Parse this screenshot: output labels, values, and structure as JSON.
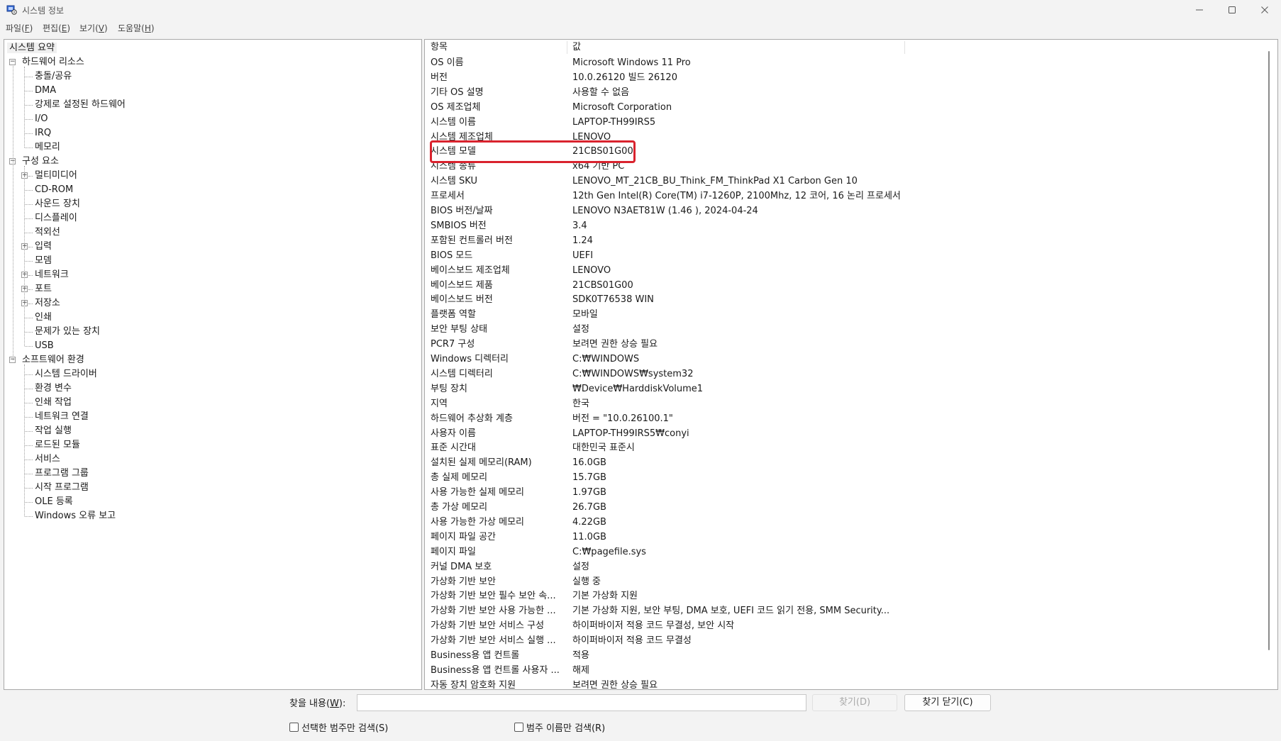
{
  "window": {
    "title": "시스템 정보"
  },
  "menu": [
    {
      "label": "파일(",
      "key": "F",
      "close": ")"
    },
    {
      "label": "편집(",
      "key": "E",
      "close": ")"
    },
    {
      "label": "보기(",
      "key": "V",
      "close": ")"
    },
    {
      "label": "도움말(",
      "key": "H",
      "close": ")"
    }
  ],
  "tree": [
    {
      "label": "시스템 요약",
      "level": 0,
      "expander": "",
      "selected": true
    },
    {
      "label": "하드웨어 리소스",
      "level": 0,
      "expander": "−"
    },
    {
      "label": "충돌/공유",
      "level": 1,
      "expander": ""
    },
    {
      "label": "DMA",
      "level": 1,
      "expander": ""
    },
    {
      "label": "강제로 설정된 하드웨어",
      "level": 1,
      "expander": ""
    },
    {
      "label": "I/O",
      "level": 1,
      "expander": ""
    },
    {
      "label": "IRQ",
      "level": 1,
      "expander": ""
    },
    {
      "label": "메모리",
      "level": 1,
      "expander": ""
    },
    {
      "label": "구성 요소",
      "level": 0,
      "expander": "−"
    },
    {
      "label": "멀티미디어",
      "level": 1,
      "expander": "+"
    },
    {
      "label": "CD-ROM",
      "level": 1,
      "expander": ""
    },
    {
      "label": "사운드 장치",
      "level": 1,
      "expander": ""
    },
    {
      "label": "디스플레이",
      "level": 1,
      "expander": ""
    },
    {
      "label": "적외선",
      "level": 1,
      "expander": ""
    },
    {
      "label": "입력",
      "level": 1,
      "expander": "+"
    },
    {
      "label": "모뎀",
      "level": 1,
      "expander": ""
    },
    {
      "label": "네트워크",
      "level": 1,
      "expander": "+"
    },
    {
      "label": "포트",
      "level": 1,
      "expander": "+"
    },
    {
      "label": "저장소",
      "level": 1,
      "expander": "+"
    },
    {
      "label": "인쇄",
      "level": 1,
      "expander": ""
    },
    {
      "label": "문제가 있는 장치",
      "level": 1,
      "expander": ""
    },
    {
      "label": "USB",
      "level": 1,
      "expander": ""
    },
    {
      "label": "소프트웨어 환경",
      "level": 0,
      "expander": "−"
    },
    {
      "label": "시스템 드라이버",
      "level": 1,
      "expander": ""
    },
    {
      "label": "환경 변수",
      "level": 1,
      "expander": ""
    },
    {
      "label": "인쇄 작업",
      "level": 1,
      "expander": ""
    },
    {
      "label": "네트워크 연결",
      "level": 1,
      "expander": ""
    },
    {
      "label": "작업 실행",
      "level": 1,
      "expander": ""
    },
    {
      "label": "로드된 모듈",
      "level": 1,
      "expander": ""
    },
    {
      "label": "서비스",
      "level": 1,
      "expander": ""
    },
    {
      "label": "프로그램 그룹",
      "level": 1,
      "expander": ""
    },
    {
      "label": "시작 프로그램",
      "level": 1,
      "expander": ""
    },
    {
      "label": "OLE 등록",
      "level": 1,
      "expander": ""
    },
    {
      "label": "Windows 오류 보고",
      "level": 1,
      "expander": ""
    }
  ],
  "table": {
    "headers": [
      "항목",
      "값"
    ],
    "rows": [
      [
        "OS 이름",
        "Microsoft Windows 11 Pro"
      ],
      [
        "버전",
        "10.0.26120 빌드 26120"
      ],
      [
        "기타 OS 설명",
        "사용할 수 없음"
      ],
      [
        "OS 제조업체",
        "Microsoft Corporation"
      ],
      [
        "시스템 이름",
        "LAPTOP-TH99IRS5"
      ],
      [
        "시스템 제조업체",
        "LENOVO"
      ],
      [
        "시스템 모델",
        "21CBS01G00"
      ],
      [
        "시스템 종류",
        "x64 기반 PC"
      ],
      [
        "시스템 SKU",
        "LENOVO_MT_21CB_BU_Think_FM_ThinkPad X1 Carbon Gen 10"
      ],
      [
        "프로세서",
        "12th Gen Intel(R) Core(TM) i7-1260P, 2100Mhz, 12 코어, 16 논리 프로세서"
      ],
      [
        "BIOS 버전/날짜",
        "LENOVO N3AET81W (1.46 ), 2024-04-24"
      ],
      [
        "SMBIOS 버전",
        "3.4"
      ],
      [
        "포함된 컨트롤러 버전",
        "1.24"
      ],
      [
        "BIOS 모드",
        "UEFI"
      ],
      [
        "베이스보드 제조업체",
        "LENOVO"
      ],
      [
        "베이스보드 제품",
        "21CBS01G00"
      ],
      [
        "베이스보드 버전",
        "SDK0T76538 WIN"
      ],
      [
        "플랫폼 역할",
        "모바일"
      ],
      [
        "보안 부팅 상태",
        "설정"
      ],
      [
        "PCR7 구성",
        "보려면 권한 상승 필요"
      ],
      [
        "Windows 디렉터리",
        "C:₩WINDOWS"
      ],
      [
        "시스템 디렉터리",
        "C:₩WINDOWS₩system32"
      ],
      [
        "부팅 장치",
        "₩Device₩HarddiskVolume1"
      ],
      [
        "지역",
        "한국"
      ],
      [
        "하드웨어 추상화 계층",
        "버전 = \"10.0.26100.1\""
      ],
      [
        "사용자 이름",
        "LAPTOP-TH99IRS5₩conyi"
      ],
      [
        "표준 시간대",
        "대한민국 표준시"
      ],
      [
        "설치된 실제 메모리(RAM)",
        "16.0GB"
      ],
      [
        "총 실제 메모리",
        "15.7GB"
      ],
      [
        "사용 가능한 실제 메모리",
        "1.97GB"
      ],
      [
        "총 가상 메모리",
        "26.7GB"
      ],
      [
        "사용 가능한 가상 메모리",
        "4.22GB"
      ],
      [
        "페이지 파일 공간",
        "11.0GB"
      ],
      [
        "페이지 파일",
        "C:₩pagefile.sys"
      ],
      [
        "커널 DMA 보호",
        "설정"
      ],
      [
        "가상화 기반 보안",
        "실행 중"
      ],
      [
        "가상화 기반 보안 필수 보안 속...",
        "기본 가상화 지원"
      ],
      [
        "가상화 기반 보안 사용 가능한 ...",
        "기본 가상화 지원, 보안 부팅, DMA 보호, UEFI 코드 읽기 전용, SMM Security..."
      ],
      [
        "가상화 기반 보안 서비스 구성",
        "하이퍼바이저 적용 코드 무결성, 보안 시작"
      ],
      [
        "가상화 기반 보안 서비스 실행 ...",
        "하이퍼바이저 적용 코드 무결성"
      ],
      [
        "Business용 앱 컨트롤",
        "적용"
      ],
      [
        "Business용 앱 컨트롤 사용자 ...",
        "해제"
      ],
      [
        "자동 장치 암호화 지원",
        "보려면 권한 상승 필요"
      ]
    ]
  },
  "find": {
    "label": "찾을 내용(",
    "label_key": "W",
    "label_close": "):",
    "value": "",
    "find_button": "찾기(D)",
    "close_button": "찾기 닫기(C)",
    "checkbox1": "선택한 범주만 검색(S)",
    "checkbox2": "범주 이름만 검색(R)"
  },
  "colors": {
    "highlight": "#d9232e",
    "selected_bg": "#f0f0f0"
  },
  "icons": {
    "app": "system-info-icon",
    "minimize": "minimize-icon",
    "maximize": "maximize-icon",
    "close": "close-icon"
  }
}
